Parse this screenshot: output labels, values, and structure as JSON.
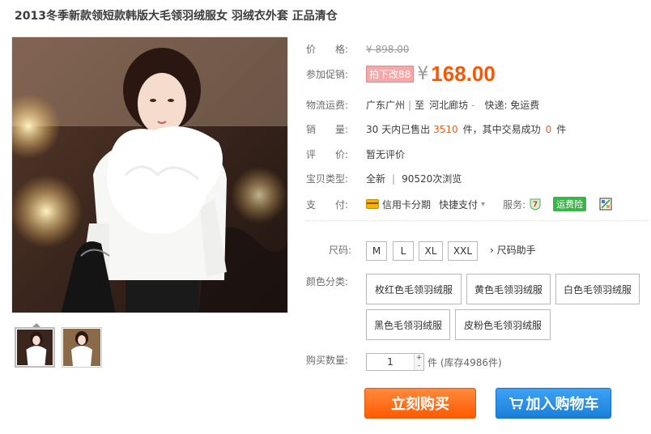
{
  "product": {
    "title": "2013冬季新款领短款韩版大毛领羽绒服女 羽绒衣外套 正品清仓"
  },
  "price": {
    "label": "价　　格:",
    "original": "¥ 898.00"
  },
  "promotion": {
    "label": "参加促销:",
    "tag": "拍下改88",
    "currency": "¥",
    "price": "168.00"
  },
  "shipping": {
    "label": "物流运费:",
    "from": "广东广州",
    "to_prefix": "至",
    "to": "河北廊坊",
    "to_arrow": "-",
    "express": "快递: 免运费"
  },
  "sales": {
    "label": "销　　量:",
    "prefix": "30 天内已售出",
    "sold": "3510",
    "middle": "件，其中交易成功",
    "success": "0",
    "suffix": "件"
  },
  "review": {
    "label": "评　　价:",
    "value": "暂无评价"
  },
  "item_type": {
    "label": "宝贝类型:",
    "condition": "全新",
    "views": "90520次浏览"
  },
  "payment": {
    "label": "支　　付:",
    "installment": "信用卡分期",
    "quick_pay": "快捷支付",
    "service_label": "服务:",
    "freight_insurance": "运费险"
  },
  "sku": {
    "size_label": "尺码:",
    "sizes": [
      "M",
      "L",
      "XL",
      "XXL"
    ],
    "size_help": "› 尺码助手",
    "color_label": "颜色分类:",
    "colors": [
      "枚红色毛领羽绒服",
      "黄色毛领羽绒服",
      "白色毛领羽绒服",
      "黑色毛领羽绒服",
      "皮粉色毛领羽绒服"
    ]
  },
  "quantity": {
    "label": "购买数量:",
    "value": "1",
    "plus": "+",
    "minus": "-",
    "stock": "件 (库存4986件)"
  },
  "actions": {
    "buy_now": "立刻购买",
    "add_to_cart": "加入购物车"
  },
  "colors": {
    "accent": "#ff5500",
    "buy_button": "#ff6a00",
    "cart_button": "#2b8de8",
    "badge_green": "#3ab54a"
  },
  "icons": {
    "installment": "credit-card-icon",
    "service_shield": "seven-day-return-icon",
    "cart": "shopping-cart-icon",
    "share": "qr-code-icon"
  }
}
